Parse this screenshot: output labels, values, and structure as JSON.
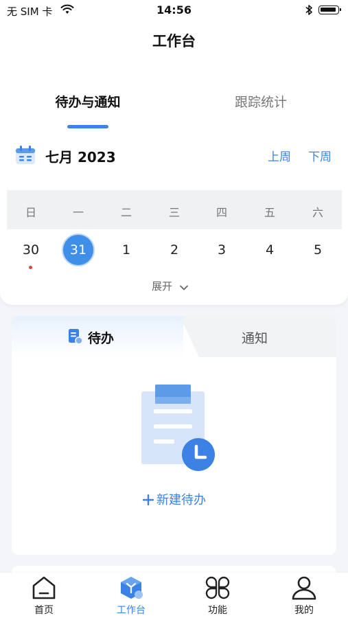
{
  "status": {
    "carrier": "无 SIM 卡",
    "time": "14:56"
  },
  "header": {
    "title": "工作台"
  },
  "tabs": [
    {
      "label": "待办与通知",
      "active": true
    },
    {
      "label": "跟踪统计",
      "active": false
    }
  ],
  "calendar": {
    "month_label": "七月 2023",
    "prev_week": "上周",
    "next_week": "下周",
    "weekdays": [
      "日",
      "一",
      "二",
      "三",
      "四",
      "五",
      "六"
    ],
    "days": [
      "30",
      "31",
      "1",
      "2",
      "3",
      "4",
      "5"
    ],
    "selected_day": "31",
    "expand_label": "展开"
  },
  "panel": {
    "segments": [
      {
        "label": "待办",
        "active": true
      },
      {
        "label": "通知",
        "active": false
      }
    ],
    "new_todo_label": "新建待办"
  },
  "bottom_nav": [
    {
      "label": "首页",
      "icon": "home-icon",
      "active": false
    },
    {
      "label": "工作台",
      "icon": "workbench-icon",
      "active": true
    },
    {
      "label": "功能",
      "icon": "functions-icon",
      "active": false
    },
    {
      "label": "我的",
      "icon": "profile-icon",
      "active": false
    }
  ],
  "colors": {
    "accent": "#3b82e4",
    "event_dot": "#e0453a"
  }
}
